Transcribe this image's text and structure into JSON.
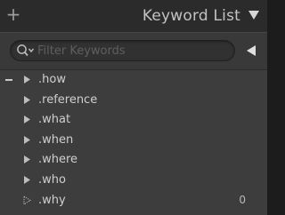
{
  "header": {
    "add_symbol": "+",
    "title": "Keyword List"
  },
  "filter": {
    "placeholder": "Filter Keywords",
    "value": ""
  },
  "keywords": [
    {
      "label": ".how",
      "count": "",
      "expanded_indicator": "minus"
    },
    {
      "label": ".reference",
      "count": ""
    },
    {
      "label": ".what",
      "count": ""
    },
    {
      "label": ".when",
      "count": ""
    },
    {
      "label": ".where",
      "count": ""
    },
    {
      "label": ".who",
      "count": ""
    },
    {
      "label": ".why",
      "count": "0"
    }
  ],
  "colors": {
    "panel_bg": "#3d3d3d",
    "header_bg": "#2b2b2b",
    "text": "#cfcfcf",
    "icon": "#b5b5b5"
  }
}
